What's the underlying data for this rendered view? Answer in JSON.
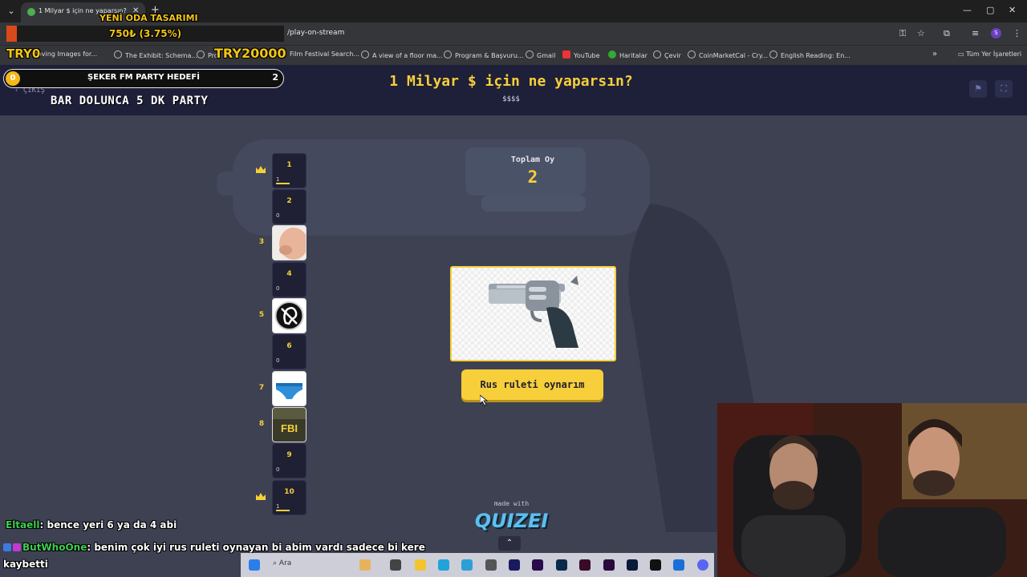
{
  "browser": {
    "tab_title": "1 Milyar $ için ne yaparsın? - Q",
    "url": "/play-on-stream",
    "profile_initial": "S",
    "bookmarks": [
      "Moving Images for...",
      "The Exhibit: Schema...",
      "Pro",
      "Film Festival Search...",
      "A view of a floor ma...",
      "Program & Başvuru...",
      "Gmail",
      "YouTube",
      "Haritalar",
      "Çevir",
      "CoinMarketCal - Cry...",
      "English Reading: En..."
    ],
    "bookmarks_folder": "Tüm Yer İşaretleri"
  },
  "overlays": {
    "room_design": "YENİ ODA TASARIMI",
    "donation_text": "750₺ (3.75%)",
    "donation_progress": 0.0375,
    "try_left": "TRY0",
    "try_right": "TRY20000"
  },
  "goal": {
    "coin": "0",
    "title": "ŞEKER FM PARTY HEDEFİ",
    "count": "2",
    "subtitle": "BAR DOLUNCA 5 DK PARTY"
  },
  "header": {
    "exit_label": "ÇIKIŞ",
    "question": "1 Milyar $ için ne yaparsın?",
    "subtitle": "$$$$"
  },
  "total": {
    "label": "Toplam Oy",
    "value": "2"
  },
  "answer": {
    "button_label": "Rus ruleti oynarım"
  },
  "ranks": [
    {
      "n": "1",
      "votes": "1",
      "crown": true,
      "fill": 0.5
    },
    {
      "n": "2",
      "votes": "0",
      "crown": false,
      "fill": 0
    },
    {
      "n": "3",
      "image": "hand-image",
      "crown": false
    },
    {
      "n": "4",
      "votes": "0",
      "crown": false,
      "fill": 0
    },
    {
      "n": "5",
      "image": "ear-icon",
      "crown": false
    },
    {
      "n": "6",
      "votes": "0",
      "crown": false,
      "fill": 0
    },
    {
      "n": "7",
      "image": "underwear-image",
      "crown": false
    },
    {
      "n": "8",
      "image": "fbi-image",
      "crown": false,
      "image_text": "FBI"
    },
    {
      "n": "9",
      "votes": "0",
      "crown": false,
      "fill": 0
    },
    {
      "n": "10",
      "votes": "1",
      "crown": true,
      "fill": 0.5
    }
  ],
  "made_with": {
    "label": "made with",
    "brand": "QUIZEI"
  },
  "chat": [
    {
      "user": "Eltaell",
      "message": ": bence yeri 6 ya da 4 abi"
    },
    {
      "user": "ButWhoOne",
      "message": ": benim çok iyi rus ruleti oynayan bi abim vardı sadece bi kere"
    },
    {
      "user": "",
      "message": "kaybetti"
    }
  ],
  "taskbar": {
    "search_placeholder": "Ara"
  },
  "colors": {
    "accent_yellow": "#f6cf3a",
    "header_bg": "#1e1f38",
    "stage_bg": "#3d4152"
  }
}
